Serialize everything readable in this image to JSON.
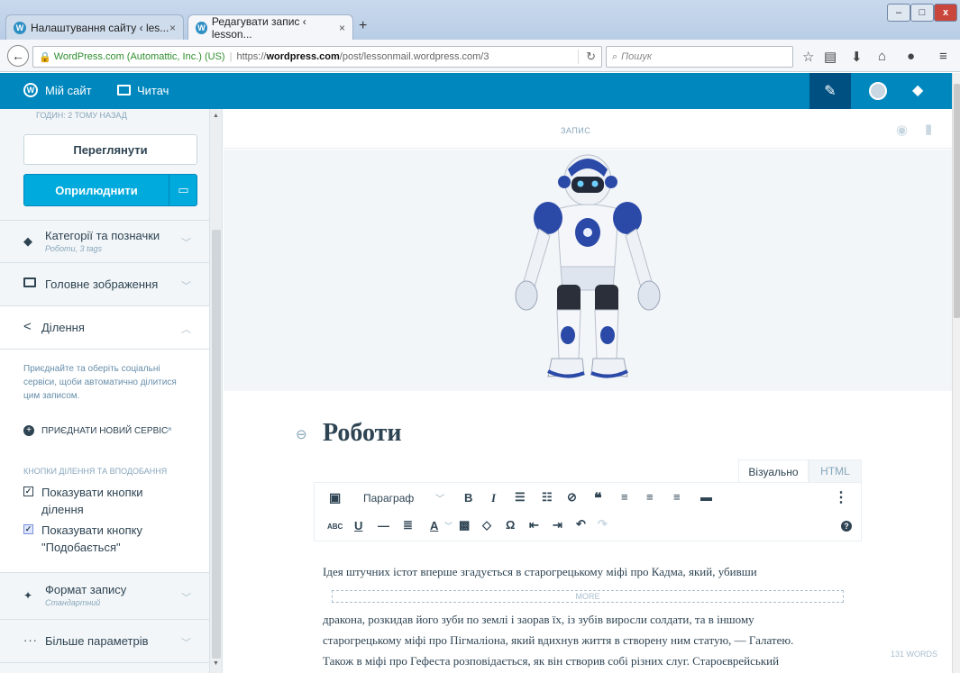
{
  "browser": {
    "tabs": [
      {
        "title": "Налаштування сайту ‹ les...",
        "active": false
      },
      {
        "title": "Редагувати запис ‹ lesson...",
        "active": true
      }
    ],
    "new_tab": "+",
    "close": "×",
    "security_label": "WordPress.com (Automattic, Inc.) (US)",
    "url_prefix": "https://",
    "url_domain": "wordpress.com",
    "url_path": "/post/lessonmail.wordpress.com/3",
    "search_placeholder": "Пошук",
    "window_buttons": [
      "–",
      "□",
      "x"
    ]
  },
  "masterbar": {
    "my_site": "Мій сайт",
    "reader": "Читач"
  },
  "sidebar": {
    "hours_ago": "ГОДИН: 2 ТОМУ НАЗАД",
    "preview_button": "Переглянути",
    "publish_button": "Оприлюднити",
    "categories": {
      "title": "Категорії та позначки",
      "sub": "Роботи, 3 tags"
    },
    "featured_image": {
      "title": "Головне зображення"
    },
    "sharing": {
      "title": "Ділення",
      "description": "Приєднайте та оберіть соціальні сервіси, щоби автоматично ділитися цим записом.",
      "connect_service": "ПРИЄДНАТИ НОВИЙ СЕРВІС",
      "buttons_heading": "КНОПКИ ДІЛЕННЯ ТА ВПОДОБАННЯ",
      "show_sharing": "Показувати кнопки ділення",
      "show_like": "Показувати кнопку \"Подобається\""
    },
    "post_format": {
      "title": "Формат запису",
      "sub": "Стандартний"
    },
    "more_options": {
      "title": "Більше параметрів"
    }
  },
  "editor": {
    "header_label": "ЗАПИС",
    "post_title": "Роботи",
    "tab_visual": "Візуально",
    "tab_html": "HTML",
    "format_select": "Параграф",
    "more_label": "MORE",
    "word_count": "131 WORDS",
    "paragraph_before_more": "Ідея штучних істот вперше згадується в старогрецькому міфі про Кадма, який, убивши",
    "paragraph_after_more": [
      "дракона, розкидав його зуби по землі і заорав їх, із зубів виросли солдати, та в іншому",
      "старогрецькому міфі про Пігмаліона, який вдихнув життя в створену ним статую, — Галатею.",
      "Також в міфі про Гефеста розповідається, як він створив собі різних слуг. Староєврейський"
    ]
  },
  "colors": {
    "masterbar": "#0087be",
    "publish": "#00aadc",
    "sidebar_bg": "#f3f6f8"
  }
}
